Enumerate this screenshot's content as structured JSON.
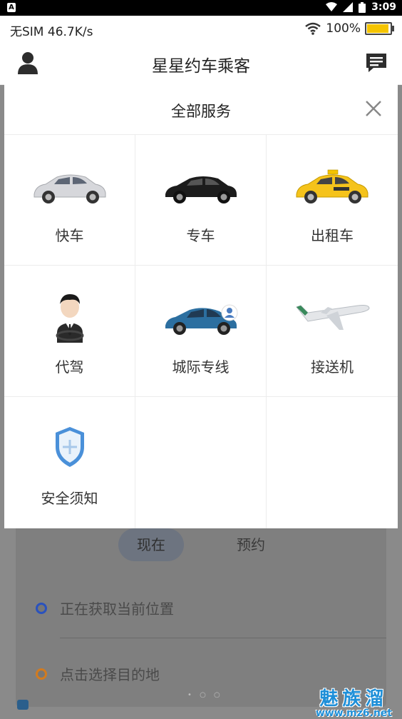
{
  "system_bar": {
    "badge": "A",
    "time": "3:09"
  },
  "status_bar": {
    "carrier": "无SIM 46.7K/s",
    "battery_pct": "100%",
    "battery_level": 1.0
  },
  "app_bar": {
    "title": "星星约车乘客"
  },
  "panel": {
    "title": "全部服务",
    "services": [
      {
        "label": "快车",
        "icon": "silver-car-icon"
      },
      {
        "label": "专车",
        "icon": "black-car-icon"
      },
      {
        "label": "出租车",
        "icon": "taxi-icon"
      },
      {
        "label": "代驾",
        "icon": "driver-icon"
      },
      {
        "label": "城际专线",
        "icon": "intercity-car-icon"
      },
      {
        "label": "接送机",
        "icon": "airplane-icon"
      },
      {
        "label": "安全须知",
        "icon": "shield-icon"
      }
    ]
  },
  "background": {
    "tab_now": "现在",
    "tab_book": "预约",
    "origin_text": "正在获取当前位置",
    "destination_text": "点击选择目的地",
    "origin_color": "#2a52be",
    "destination_color": "#d27b1f"
  },
  "watermark": {
    "big": "魅族溜",
    "small": "www.mz6.net"
  }
}
